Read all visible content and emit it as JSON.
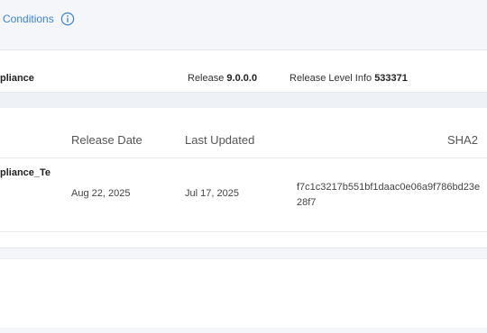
{
  "header": {
    "conditions_link": "Conditions",
    "info_icon": "info-circle-icon"
  },
  "product": {
    "name_fragment": "pliance",
    "release_label": "Release",
    "release_value": "9.0.0.0",
    "release_level_label": "Release Level Info",
    "release_level_value": "533371"
  },
  "table": {
    "columns": [
      "Release Date",
      "Last Updated",
      "SHA2"
    ],
    "rows": [
      {
        "file": "pliance_Te",
        "release_date": "Aug 22, 2025",
        "last_updated": "Jul 17, 2025",
        "sha2_line1": "f7c1c3217b551bf1daac0e06a9f786bd23e",
        "sha2_line2": "28f7"
      }
    ]
  },
  "colors": {
    "link": "#3a84d6",
    "page_bg": "#f4f6f9",
    "panel_bg": "#ffffff"
  }
}
